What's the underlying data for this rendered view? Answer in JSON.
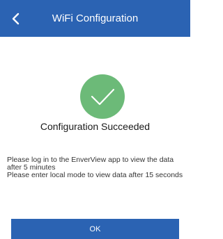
{
  "header": {
    "title": "WiFi Configuration",
    "back_icon": "chevron-left-icon"
  },
  "status": {
    "icon": "checkmark-circle-icon",
    "title": "Configuration Succeeded"
  },
  "message": {
    "line1": "Please log in to the EnverView app to view the data after 5 minutes",
    "line2": " Please enter local mode to view data after 15 seconds"
  },
  "actions": {
    "ok_label": "OK"
  },
  "colors": {
    "header_bg": "#2b63b3",
    "success_green": "#6cba78",
    "button_bg": "#2b63b3"
  }
}
